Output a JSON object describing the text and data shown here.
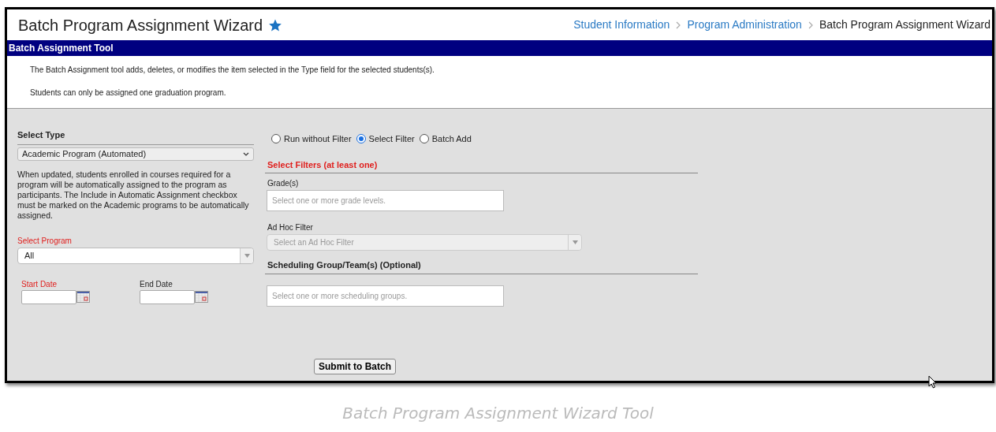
{
  "header": {
    "title": "Batch Program Assignment Wizard",
    "favorite": true,
    "breadcrumbs": [
      {
        "label": "Student Information",
        "kind": "link"
      },
      {
        "label": "Program Administration",
        "kind": "link"
      },
      {
        "label": "Batch Program Assignment Wizard",
        "kind": "current"
      }
    ]
  },
  "tool_bar": {
    "title": "Batch Assignment Tool"
  },
  "description": [
    "The Batch Assignment tool adds, deletes, or modifies the item selected in the Type field for the selected students(s).",
    "Students can only be assigned one graduation program."
  ],
  "select_type": {
    "label": "Select Type",
    "value": "Academic Program (Automated)",
    "help": "When updated, students enrolled in courses required for a program will be automatically assigned to the program as participants. The Include in Automatic Assignment checkbox must be marked on the Academic programs to be automatically assigned."
  },
  "select_program": {
    "label": "Select Program",
    "required": true,
    "value": "All"
  },
  "dates": [
    {
      "label": "Start Date",
      "required": true
    },
    {
      "label": "End Date",
      "required": false
    }
  ],
  "filter_modes": [
    {
      "label": "Run without Filter",
      "selected": false
    },
    {
      "label": "Select Filter",
      "selected": true
    },
    {
      "label": "Batch Add",
      "selected": false
    }
  ],
  "filters": {
    "heading": "Select Filters (at least one)",
    "grades": {
      "label": "Grade(s)",
      "placeholder": "Select one or more grade levels."
    },
    "ad_hoc": {
      "label": "Ad Hoc Filter",
      "placeholder": "Select an Ad Hoc Filter"
    }
  },
  "scheduling": {
    "heading": "Scheduling Group/Team(s) (Optional)",
    "placeholder": "Select one or more scheduling groups."
  },
  "submit_button": "Submit to Batch",
  "caption": "Batch Program Assignment Wizard Tool"
}
